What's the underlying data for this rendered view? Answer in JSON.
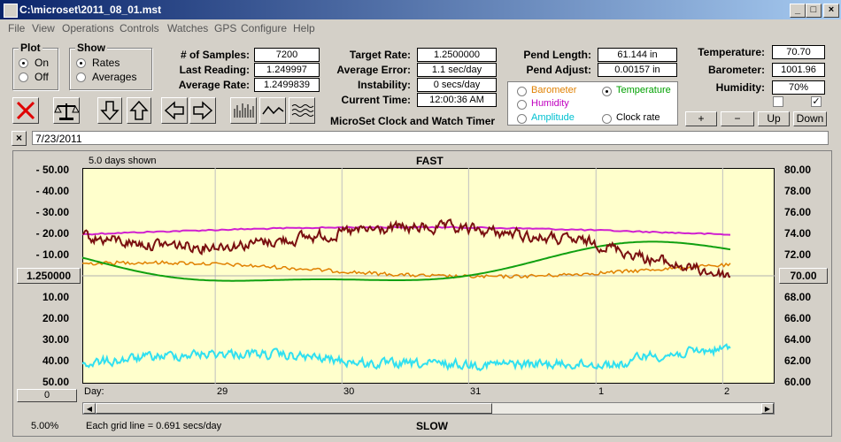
{
  "window": {
    "title": "C:\\microset\\2011_08_01.mst"
  },
  "menu": [
    "File",
    "View",
    "Operations",
    "Controls",
    "Watches",
    "GPS",
    "Configure",
    "Help"
  ],
  "plot_group": {
    "title": "Plot",
    "options": [
      "On",
      "Off"
    ],
    "selected": "On"
  },
  "show_group": {
    "title": "Show",
    "options": [
      "Rates",
      "Averages"
    ],
    "selected": "Rates"
  },
  "stats": {
    "samples_label": "# of Samples:",
    "samples": "7200",
    "last_label": "Last Reading:",
    "last": "1.249997",
    "avg_label": "Average Rate:",
    "avg": "1.2499839"
  },
  "target": {
    "rate_label": "Target Rate:",
    "rate": "1.2500000",
    "err_label": "Average Error:",
    "err": "1.1 sec/day",
    "inst_label": "Instability:",
    "inst": "0 secs/day",
    "time_label": "Current Time:",
    "time": "12:00:36 AM",
    "app_name": "MicroSet Clock and Watch Timer"
  },
  "pend": {
    "length_label": "Pend Length:",
    "length": "61.144 in",
    "adjust_label": "Pend Adjust:",
    "adjust": "0.00157 in"
  },
  "series_select": {
    "barometer": "Barometer",
    "temperature": "Temperature",
    "humidity": "Humidity",
    "amplitude": "Amplitude",
    "clock_rate": "Clock rate",
    "selected": "Temperature",
    "colors": {
      "barometer": "#e08000",
      "temperature": "#00a000",
      "humidity": "#c000c0",
      "amplitude": "#00d0e0",
      "clock_rate": "#000000"
    }
  },
  "env": {
    "temp_label": "Temperature:",
    "temp": "70.70",
    "baro_label": "Barometer:",
    "baro": "1001.96",
    "hum_label": "Humidity:",
    "hum": "70%",
    "buttons": [
      "+",
      "−",
      "Up",
      "Down"
    ]
  },
  "date_field": "7/23/2011",
  "chart": {
    "days_shown": "5.0 days shown",
    "top_label": "FAST",
    "bottom_label": "SLOW",
    "left_ticks": [
      "- 50.00",
      "- 40.00",
      "- 30.00",
      "- 20.00",
      "- 10.00",
      "10.00",
      "20.00",
      "30.00",
      "40.00",
      "50.00"
    ],
    "center_value": "1.250000",
    "right_ticks": [
      "80.00",
      "78.00",
      "76.00",
      "74.00",
      "72.00",
      "68.00",
      "66.00",
      "64.00",
      "62.00",
      "60.00"
    ],
    "right_center": "70.00",
    "x_ticks": [
      "Day:",
      "29",
      "30",
      "31",
      "1",
      "2"
    ],
    "zero_value": "0",
    "percent": "5.00%",
    "grid_note": "Each grid line = 0.691 secs/day",
    "colors": {
      "plot_bg": "#ffffcc",
      "rate": "#7a1010",
      "humidity": "#d020d0",
      "barometer": "#e08000",
      "temperature": "#10a010",
      "amplitude": "#30e0f0"
    }
  }
}
